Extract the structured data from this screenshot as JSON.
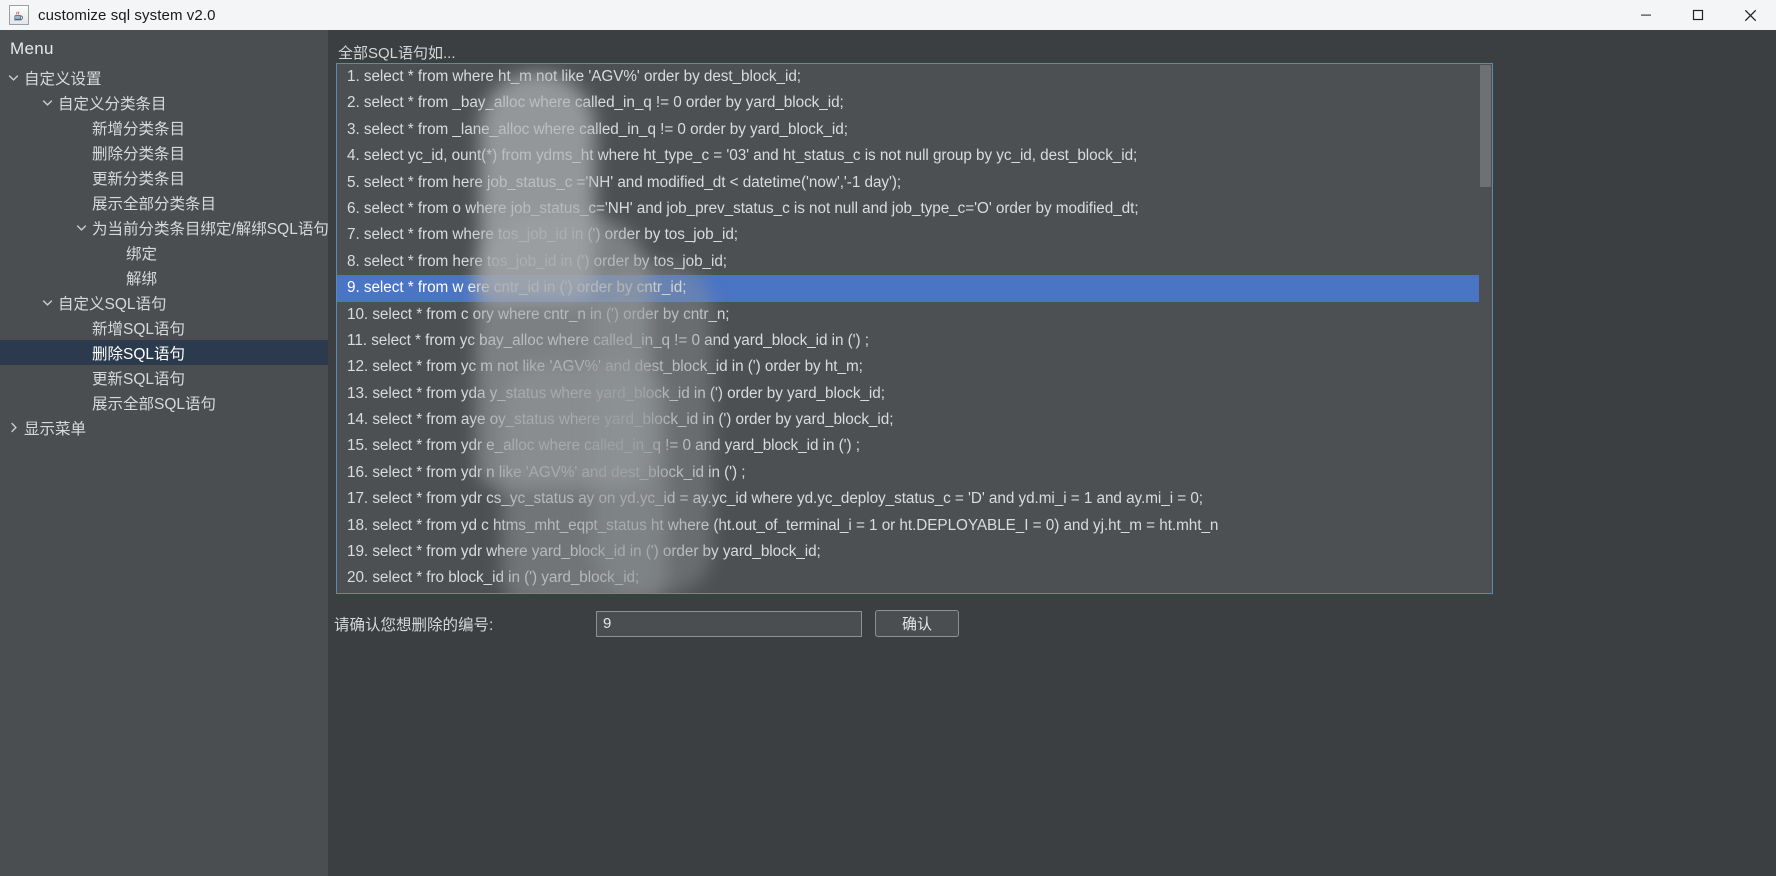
{
  "window": {
    "title": "customize sql system v2.0",
    "icon": "java-coffee-cup-icon",
    "minimize_label": "—",
    "maximize_label": "☐",
    "close_label": "✕"
  },
  "sidebar": {
    "heading": "Menu",
    "items": [
      {
        "label": "自定义设置",
        "level": 1,
        "twisty": "expanded",
        "selected": false
      },
      {
        "label": "自定义分类条目",
        "level": 2,
        "twisty": "expanded",
        "selected": false
      },
      {
        "label": "新增分类条目",
        "level": 3,
        "twisty": "none",
        "selected": false
      },
      {
        "label": "删除分类条目",
        "level": 3,
        "twisty": "none",
        "selected": false
      },
      {
        "label": "更新分类条目",
        "level": 3,
        "twisty": "none",
        "selected": false
      },
      {
        "label": "展示全部分类条目",
        "level": 3,
        "twisty": "none",
        "selected": false
      },
      {
        "label": "为当前分类条目绑定/解绑SQL语句",
        "level": 3,
        "twisty": "expanded",
        "selected": false
      },
      {
        "label": "绑定",
        "level": 4,
        "twisty": "none",
        "selected": false
      },
      {
        "label": "解绑",
        "level": 4,
        "twisty": "none",
        "selected": false
      },
      {
        "label": "自定义SQL语句",
        "level": 2,
        "twisty": "expanded",
        "selected": false
      },
      {
        "label": "新增SQL语句",
        "level": 3,
        "twisty": "none",
        "selected": false
      },
      {
        "label": "删除SQL语句",
        "level": 3,
        "twisty": "none",
        "selected": true
      },
      {
        "label": "更新SQL语句",
        "level": 3,
        "twisty": "none",
        "selected": false
      },
      {
        "label": "展示全部SQL语句",
        "level": 3,
        "twisty": "none",
        "selected": false
      },
      {
        "label": "显示菜单",
        "level": 1,
        "twisty": "collapsed",
        "selected": false
      }
    ],
    "twisty_expanded_glyph": "⌄",
    "twisty_collapsed_glyph": "›"
  },
  "main": {
    "list_caption": "全部SQL语句如...",
    "selected_index": 9,
    "rows": [
      {
        "num": "1.",
        "text": "select * from                  where ht_m not like 'AGV%' order by dest_block_id;"
      },
      {
        "num": "2.",
        "text": "select * from                        _bay_alloc where called_in_q != 0 order by yard_block_id;"
      },
      {
        "num": "3.",
        "text": "select * from                         _lane_alloc where called_in_q != 0 order by yard_block_id;"
      },
      {
        "num": "4.",
        "text": "select yc_id,                 ount(*) from ydms_ht where ht_type_c = '03' and ht_status_c is not null group by yc_id, dest_block_id;"
      },
      {
        "num": "5.",
        "text": "select * from                  here job_status_c ='NH' and  modified_dt < datetime('now','-1 day');"
      },
      {
        "num": "6.",
        "text": "select * from        o              where job_status_c='NH' and job_prev_status_c is not null and job_type_c='O' order by modified_dt;"
      },
      {
        "num": "7.",
        "text": "select * from                      where tos_job_id in (') order by tos_job_id;"
      },
      {
        "num": "8.",
        "text": "select * from                   here tos_job_id in (') order by tos_job_id;"
      },
      {
        "num": "9.",
        "text": "select * from w                 ere cntr_id in (') order by cntr_id;"
      },
      {
        "num": "10.",
        "text": "select * from c                ory where cntr_n in (') order by cntr_n;"
      },
      {
        "num": "11.",
        "text": "select * from yc                  bay_alloc where called_in_q != 0 and yard_block_id in (') ;"
      },
      {
        "num": "12.",
        "text": "select * from yc                  m not like 'AGV%' and dest_block_id in (') order by ht_m;"
      },
      {
        "num": "13.",
        "text": "select * from yda                y_status where yard_block_id in (') order by yard_block_id;"
      },
      {
        "num": "14.",
        "text": "select * from aye                 oy_status where yard_block_id in (') order by yard_block_id;"
      },
      {
        "num": "15.",
        "text": "select * from ydr                 e_alloc where called_in_q != 0 and yard_block_id in (') ;"
      },
      {
        "num": "16.",
        "text": "select * from ydr                 n like 'AGV%' and dest_block_id in (') ;"
      },
      {
        "num": "17.",
        "text": "select * from ydr              cs_yc_status ay on yd.yc_id = ay.yc_id where yd.yc_deploy_status_c = 'D' and yd.mi_i = 1 and ay.mi_i = 0;"
      },
      {
        "num": "18.",
        "text": "select * from yd         c                htms_mht_eqpt_status ht where (ht.out_of_terminal_i = 1 or ht.DEPLOYABLE_I = 0) and yj.ht_m = ht.mht_n"
      },
      {
        "num": "19.",
        "text": "select * from ydr          where yard_block_id in (') order by yard_block_id;"
      },
      {
        "num": "20.",
        "text": "select * fro                                            block_id in (')    yard_block_id;"
      }
    ]
  },
  "form": {
    "label": "请确认您想删除的编号:",
    "input_value": "9",
    "input_placeholder": "",
    "confirm_label": "确认"
  },
  "colors": {
    "titlebar_bg": "#f3f5f7",
    "sidebar_bg": "#4b4e50",
    "main_bg": "#3c3f41",
    "list_bg": "#4d5052",
    "list_border": "#5c8ab5",
    "row_selected": "#4a74c4",
    "tree_selected": "#2b3b4d",
    "text": "#d9dbdd"
  }
}
